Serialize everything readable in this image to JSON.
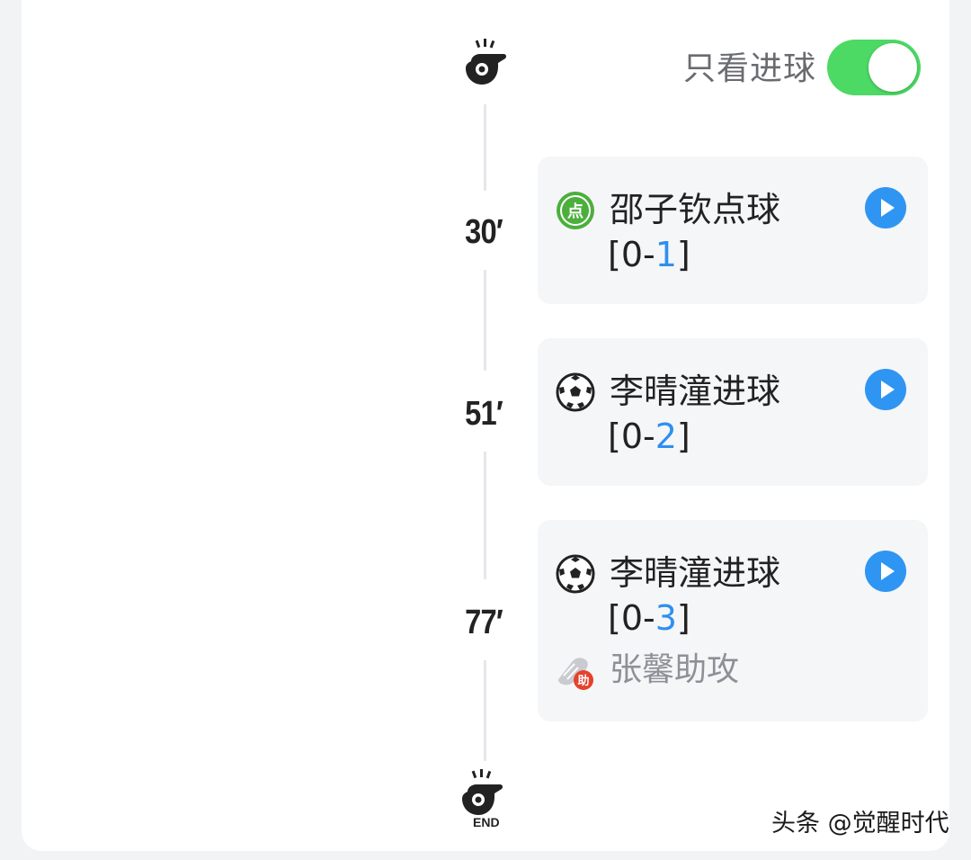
{
  "filter": {
    "label": "只看进球",
    "enabled": true
  },
  "events": [
    {
      "minute": "30′",
      "icon": "penalty-icon",
      "title": "邵子钦点球",
      "score_prefix": "[0-",
      "score_highlight": "1",
      "score_suffix": "]",
      "assist": ""
    },
    {
      "minute": "51′",
      "icon": "soccer-ball-icon",
      "title": "李晴潼进球",
      "score_prefix": "[0-",
      "score_highlight": "2",
      "score_suffix": "]",
      "assist": ""
    },
    {
      "minute": "77′",
      "icon": "soccer-ball-icon",
      "title": "李晴潼进球",
      "score_prefix": "[0-",
      "score_highlight": "3",
      "score_suffix": "]",
      "assist": "张馨助攻",
      "assist_badge": "助"
    }
  ],
  "end_label": "END",
  "penalty_badge": "点",
  "watermark": "头条 @觉醒时代",
  "colors": {
    "toggle_on": "#4cd964",
    "play_button": "#2f95f2",
    "score_highlight": "#2f8ff0",
    "penalty_green": "#4caf3c"
  }
}
